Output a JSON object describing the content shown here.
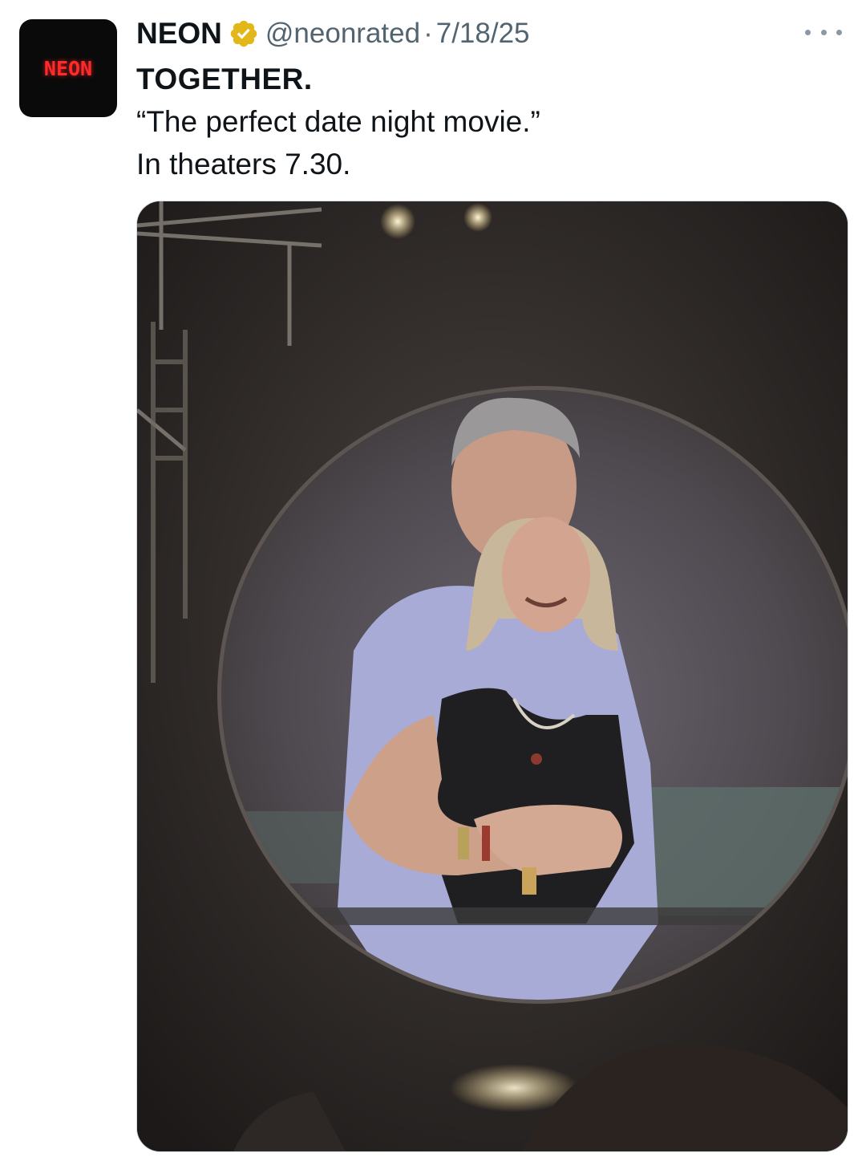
{
  "tweet": {
    "avatar": {
      "text": "NEON",
      "icon": "neon-logo"
    },
    "author_name": "NEON",
    "verified_badge_icon": "verified-badge-icon",
    "handle": "@neonrated",
    "separator": "·",
    "date": "7/18/25",
    "more_icon": "more-options-icon",
    "lines": [
      "TOGETHER.",
      "“The perfect date night movie.”",
      "In theaters 7.30."
    ],
    "media": {
      "kind": "photo"
    }
  },
  "colors": {
    "badge_gold": "#e2b719",
    "neon_red": "#ff2a2a",
    "secondary_text": "#536471"
  }
}
